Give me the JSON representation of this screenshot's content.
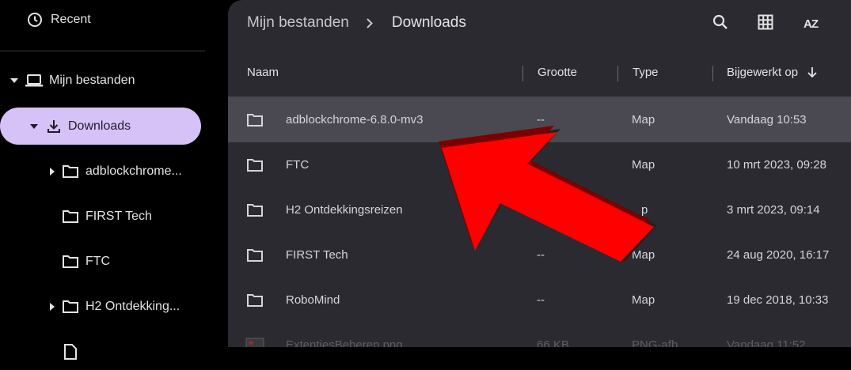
{
  "sidebar": {
    "recent_label": "Recent",
    "my_files_label": "Mijn bestanden",
    "downloads_label": "Downloads",
    "tree": [
      {
        "label": "adblockchrome...",
        "expandable": true
      },
      {
        "label": "FIRST Tech",
        "expandable": false
      },
      {
        "label": "FTC",
        "expandable": false
      },
      {
        "label": "H2 Ontdekking...",
        "expandable": true
      }
    ]
  },
  "header": {
    "breadcrumb_root": "Mijn bestanden",
    "breadcrumb_current": "Downloads",
    "sort_icon_text": "AZ"
  },
  "columns": {
    "name": "Naam",
    "size": "Grootte",
    "type": "Type",
    "modified": "Bijgewerkt op"
  },
  "files": [
    {
      "name": "adblockchrome-6.8.0-mv3",
      "size": "--",
      "type": "Map",
      "modified": "Vandaag 10:53",
      "selected": true
    },
    {
      "name": "FTC",
      "size": "",
      "type": "Map",
      "modified": "10 mrt 2023, 09:28"
    },
    {
      "name": "H2 Ontdekkingsreizen",
      "size": "",
      "type": "p",
      "modified": "3 mrt 2023, 09:14"
    },
    {
      "name": "FIRST Tech",
      "size": "--",
      "type": "Map",
      "modified": "24 aug 2020, 16:17"
    },
    {
      "name": "RoboMind",
      "size": "--",
      "type": "Map",
      "modified": "19 dec 2018, 10:33"
    },
    {
      "name": "ExtentiesBeheren.png",
      "size": "66 KB",
      "type": "PNG-afb",
      "modified": "Vandaag 11:52",
      "faded": true
    }
  ],
  "colors": {
    "accent_pill": "#d7c2f7",
    "panel": "#2b2a30",
    "selected_row": "#4a4850",
    "annotation_arrow": "#ff0000"
  }
}
